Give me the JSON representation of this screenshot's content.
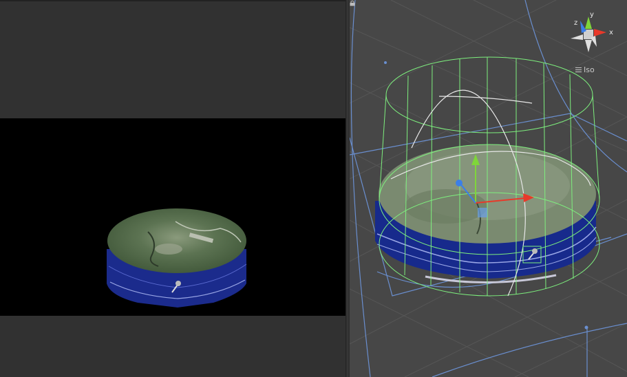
{
  "scene_view": {
    "projection_label": "Iso",
    "axes": {
      "x": "x",
      "y": "y",
      "z": "z"
    },
    "colors": {
      "background": "#474747",
      "grid": "#5a5a5a",
      "wireframe": "#7ef07e",
      "selection": "#6a8fd0",
      "x_axis": "#e8392a",
      "y_axis": "#7fd63a",
      "z_axis": "#3b7fe8"
    }
  },
  "game_view": {
    "colors": {
      "frame": "#313131",
      "viewport": "#000000",
      "cylinder_side": "#1a2a8a"
    }
  }
}
